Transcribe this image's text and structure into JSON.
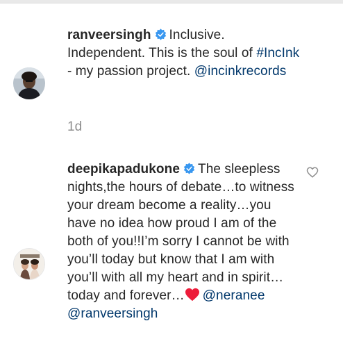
{
  "comments": [
    {
      "username": "ranveersingh",
      "verified": true,
      "text_plain": "Inclusive. Independent. This is the soul of",
      "hashtag": "#IncInk",
      "text_after_hashtag": "- my passion project.",
      "mention": "@incinkrecords",
      "time": "1d",
      "avatar_icon": "avatar-man-photo"
    },
    {
      "username": "deepikapadukone",
      "verified": true,
      "text_plain": "The sleepless nights,the hours of debate…to witness your dream become a reality…you have no idea how proud I am of the both of you!!I’m sorry I cannot be with you’ll today but know that I am with you’ll with all my heart and in spirit…today and forever…",
      "emoji": "red-heart-emoji",
      "mention_1": "@neranee",
      "mention_2": "@ranveersingh",
      "avatar_icon": "avatar-magazine-photo",
      "like_icon": "heart-outline-icon"
    }
  ],
  "colors": {
    "text": "#262626",
    "link": "#00376b",
    "muted": "#8e8e8e",
    "verified": "#3897f0",
    "heart": "#ed1c3a"
  }
}
